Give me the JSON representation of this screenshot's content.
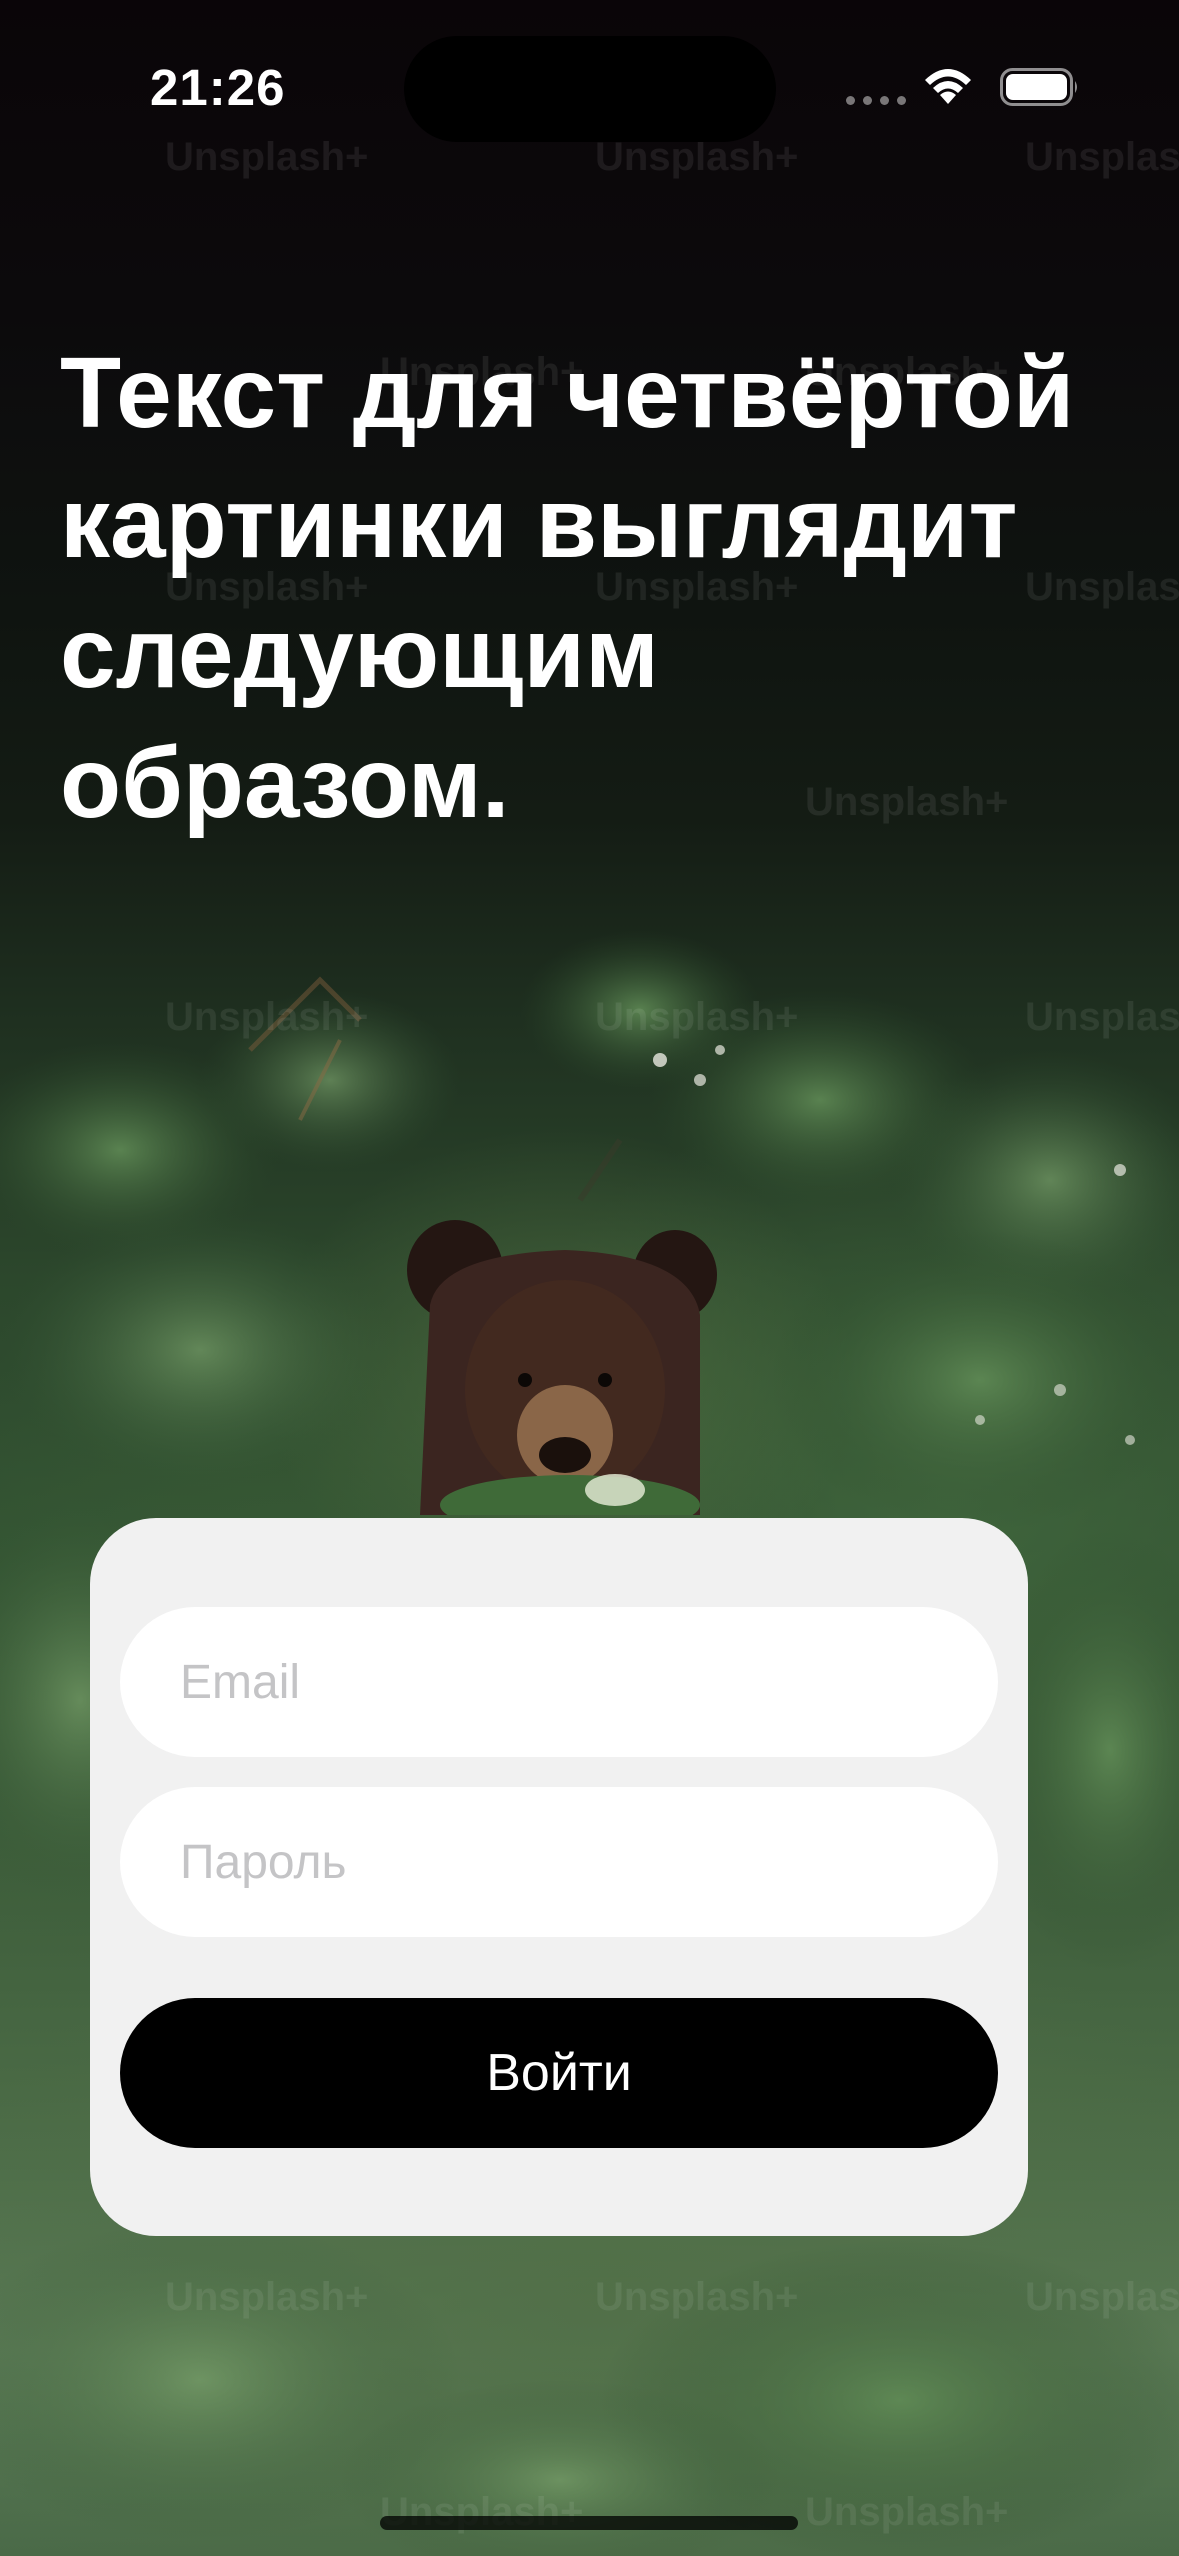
{
  "status_bar": {
    "time": "21:26"
  },
  "background": {
    "watermark_text": "Unsplash+",
    "subject": "bear-in-foliage-photo"
  },
  "headline": {
    "text": "Текст для четвёртой картинки выглядит следующим образом."
  },
  "login_form": {
    "email_placeholder": "Email",
    "email_value": "",
    "password_placeholder": "Пароль",
    "password_value": "",
    "submit_label": "Войти"
  },
  "colors": {
    "card_background": "#f1f1f1",
    "button_background": "#000000",
    "button_text": "#ffffff",
    "placeholder": "#c4c4c6",
    "headline": "#ffffff"
  },
  "icons": {
    "wifi": "wifi-icon",
    "battery": "battery-icon",
    "signal": "signal-dots-icon"
  }
}
